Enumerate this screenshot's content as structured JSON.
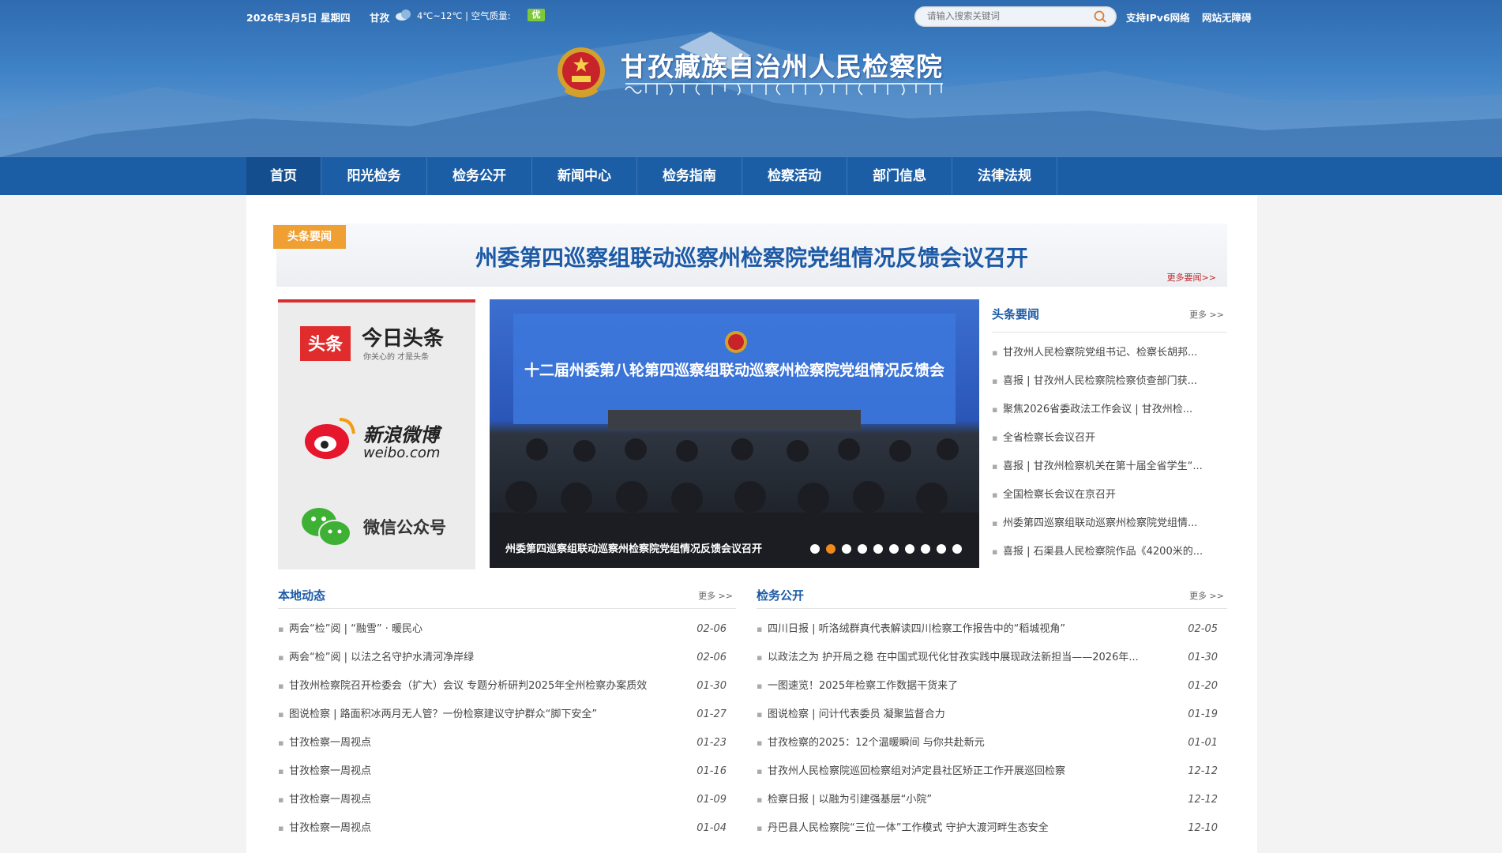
{
  "topbar": {
    "date": "2026年3月5日 星期四",
    "weather_city": "甘孜",
    "temperature": "4℃~12℃ | 空气质量:",
    "air_quality": "优",
    "search_placeholder": "请输入搜索关键词",
    "ipv6": "支持IPv6网络",
    "accessibility": "网站无障碍"
  },
  "site": {
    "title": "甘孜藏族自治州人民检察院",
    "tibetan_title": "༄༅། དཀར་མཛེས་བོད་རིགས་རང་སྐྱོང་ཁུལ་མི་དམངས་ཞིབ་དཔྱོད་ཁང་།"
  },
  "nav": [
    "首页",
    "阳光检务",
    "检务公开",
    "新闻中心",
    "检务指南",
    "检察活动",
    "部门信息",
    "法律法规"
  ],
  "headline": {
    "tag": "头条要闻",
    "title": "州委第四巡察组联动巡察州检察院党组情况反馈会议召开",
    "more": "更多要闻>>"
  },
  "social": {
    "toutiao_badge": "头条",
    "toutiao_name": "今日头条",
    "toutiao_slogan": "你关心的 才是头条",
    "weibo_name": "新浪微博",
    "weibo_domain": "weibo.com",
    "wechat_name": "微信公众号"
  },
  "slide": {
    "banner": "十二届州委第八轮第四巡察组联动巡察州检察院党组情况反馈会",
    "caption": "州委第四巡察组联动巡察州检察院党组情况反馈会议召开",
    "dot_count": 10,
    "active_dot": 1
  },
  "headlines_panel": {
    "title": "头条要闻",
    "more": "更多 >>",
    "items": [
      "甘孜州人民检察院党组书记、检察长胡邦...",
      "喜报 | 甘孜州人民检察院检察侦查部门获...",
      "聚焦2026省委政法工作会议 | 甘孜州检...",
      "全省检察长会议召开",
      "喜报 | 甘孜州检察机关在第十届全省学生“...",
      "全国检察长会议在京召开",
      "州委第四巡察组联动巡察州检察院党组情...",
      "喜报 | 石渠县人民检察院作品《4200米的..."
    ]
  },
  "local": {
    "title": "本地动态",
    "more": "更多 >>",
    "items": [
      {
        "text": "两会“检”阅 | “融雪” · 暖民心",
        "date": "02-06"
      },
      {
        "text": "两会“检”阅 | 以法之名守护水清河净岸绿",
        "date": "02-06"
      },
      {
        "text": "甘孜州检察院召开检委会（扩大）会议 专题分析研判2025年全州检察办案质效",
        "date": "01-30"
      },
      {
        "text": "图说检察 | 路面积冰两月无人管？一份检察建议守护群众“脚下安全”",
        "date": "01-27"
      },
      {
        "text": "甘孜检察一周视点",
        "date": "01-23"
      },
      {
        "text": "甘孜检察一周视点",
        "date": "01-16"
      },
      {
        "text": "甘孜检察一周视点",
        "date": "01-09"
      },
      {
        "text": "甘孜检察一周视点",
        "date": "01-04"
      }
    ]
  },
  "public": {
    "title": "检务公开",
    "more": "更多 >>",
    "items": [
      {
        "text": "四川日报 | 听洛绒群真代表解读四川检察工作报告中的“稻城视角”",
        "date": "02-05"
      },
      {
        "text": "以政法之为 护开局之稳 在中国式现代化甘孜实践中展现政法新担当——2026年...",
        "date": "01-30"
      },
      {
        "text": "一图速览！2025年检察工作数据干货来了",
        "date": "01-20"
      },
      {
        "text": "图说检察 | 问计代表委员 凝聚监督合力",
        "date": "01-19"
      },
      {
        "text": "甘孜检察的2025：12个温暖瞬间 与你共赴新元",
        "date": "01-01"
      },
      {
        "text": "甘孜州人民检察院巡回检察组对泸定县社区矫正工作开展巡回检察",
        "date": "12-12"
      },
      {
        "text": "检察日报 | 以融为引建强基层“小院”",
        "date": "12-12"
      },
      {
        "text": "丹巴县人民检察院“三位一体”工作模式 守护大渡河畔生态安全",
        "date": "12-10"
      }
    ]
  },
  "colors": {
    "nav": "#1c5ea6",
    "accent_blue": "#1d5aa6",
    "tag_orange": "#f0a032",
    "red": "#d62e2e"
  }
}
